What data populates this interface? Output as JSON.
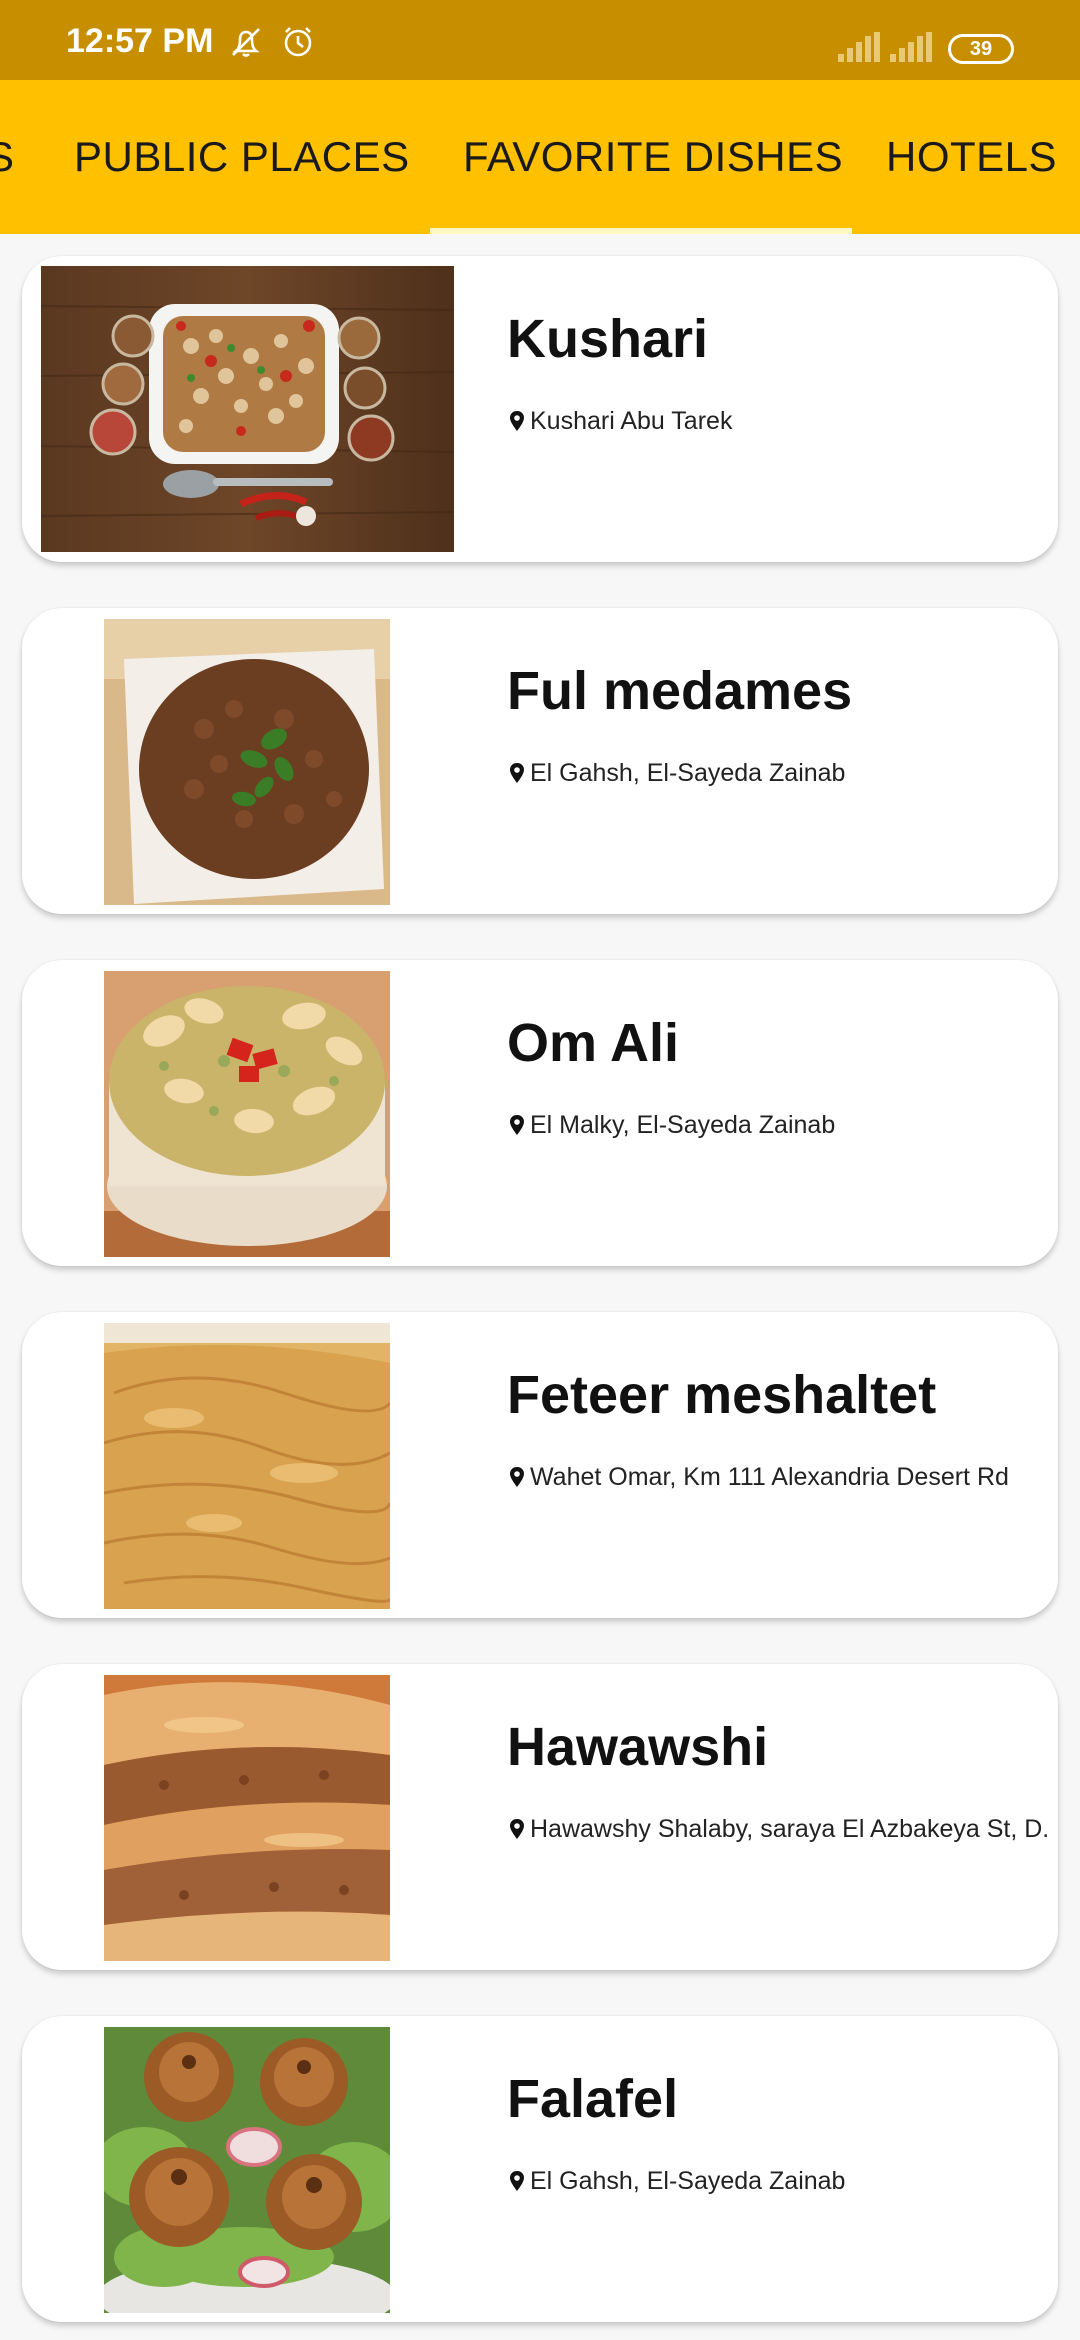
{
  "status_bar": {
    "time": "12:57 PM",
    "battery": "39",
    "icons": [
      "muted-alarm-icon",
      "alarm-clock-icon",
      "signal-icon",
      "signal-icon",
      "battery-icon"
    ]
  },
  "tabs": [
    {
      "label": "S"
    },
    {
      "label": "PUBLIC PLACES"
    },
    {
      "label": "FAVORITE DISHES"
    },
    {
      "label": "HOTELS"
    }
  ],
  "selected_tab": "FAVORITE DISHES",
  "colors": {
    "status_bar": "#c78f00",
    "tab_bar": "#ffc000",
    "indicator": "#fff7c2"
  },
  "dishes": [
    {
      "name": "Kushari",
      "location": "Kushari Abu Tarek",
      "icon": "location-pin-icon"
    },
    {
      "name": "Ful medames",
      "location": "El Gahsh, El-Sayeda Zainab",
      "icon": "location-pin-icon"
    },
    {
      "name": "Om Ali",
      "location": "El Malky, El-Sayeda Zainab",
      "icon": "location-pin-icon"
    },
    {
      "name": "Feteer meshaltet",
      "location": "Wahet Omar, Km 111 Alexandria Desert Rd",
      "icon": "location-pin-icon"
    },
    {
      "name": "Hawawshi",
      "location": "Hawawshy Shalaby, saraya El Azbakeya St, D...",
      "icon": "location-pin-icon"
    },
    {
      "name": "Falafel",
      "location": "El Gahsh, El-Sayeda Zainab",
      "icon": "location-pin-icon"
    }
  ]
}
